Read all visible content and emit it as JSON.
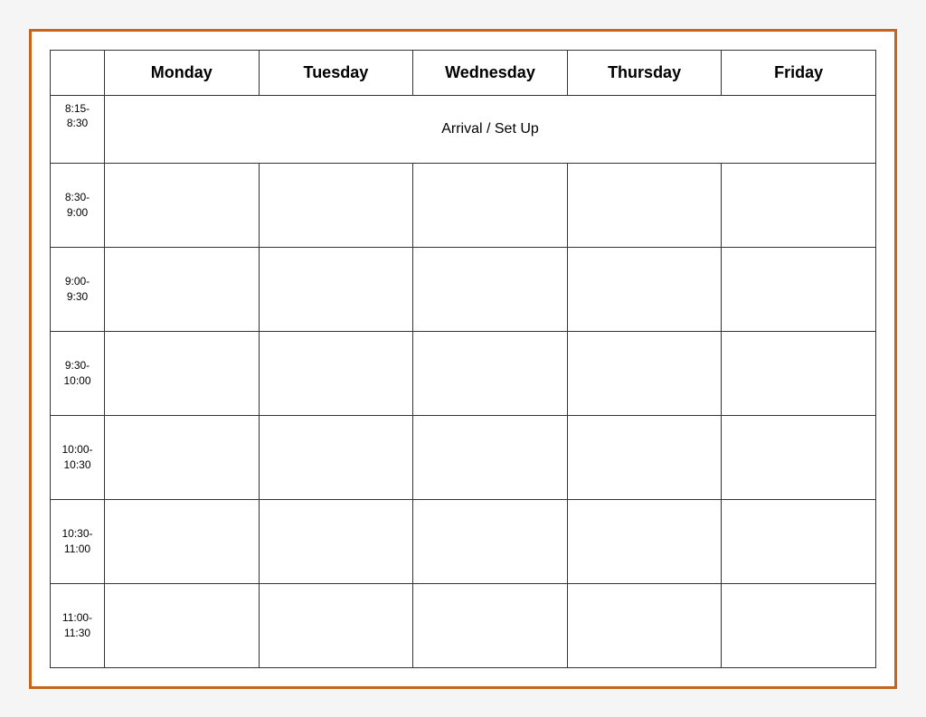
{
  "table": {
    "headers": {
      "time": "",
      "monday": "Monday",
      "tuesday": "Tuesday",
      "wednesday": "Wednesday",
      "thursday": "Thursday",
      "friday": "Friday"
    },
    "rows": [
      {
        "time": "8:15-\n8:30",
        "is_arrival": true,
        "arrival_text": "Arrival / Set Up"
      },
      {
        "time": "8:30-\n9:00",
        "is_arrival": false
      },
      {
        "time": "9:00-\n9:30",
        "is_arrival": false
      },
      {
        "time": "9:30-\n10:00",
        "is_arrival": false
      },
      {
        "time": "10:00-\n10:30",
        "is_arrival": false
      },
      {
        "time": "10:30-\n11:00",
        "is_arrival": false
      },
      {
        "time": "11:00-\n11:30",
        "is_arrival": false
      }
    ]
  }
}
